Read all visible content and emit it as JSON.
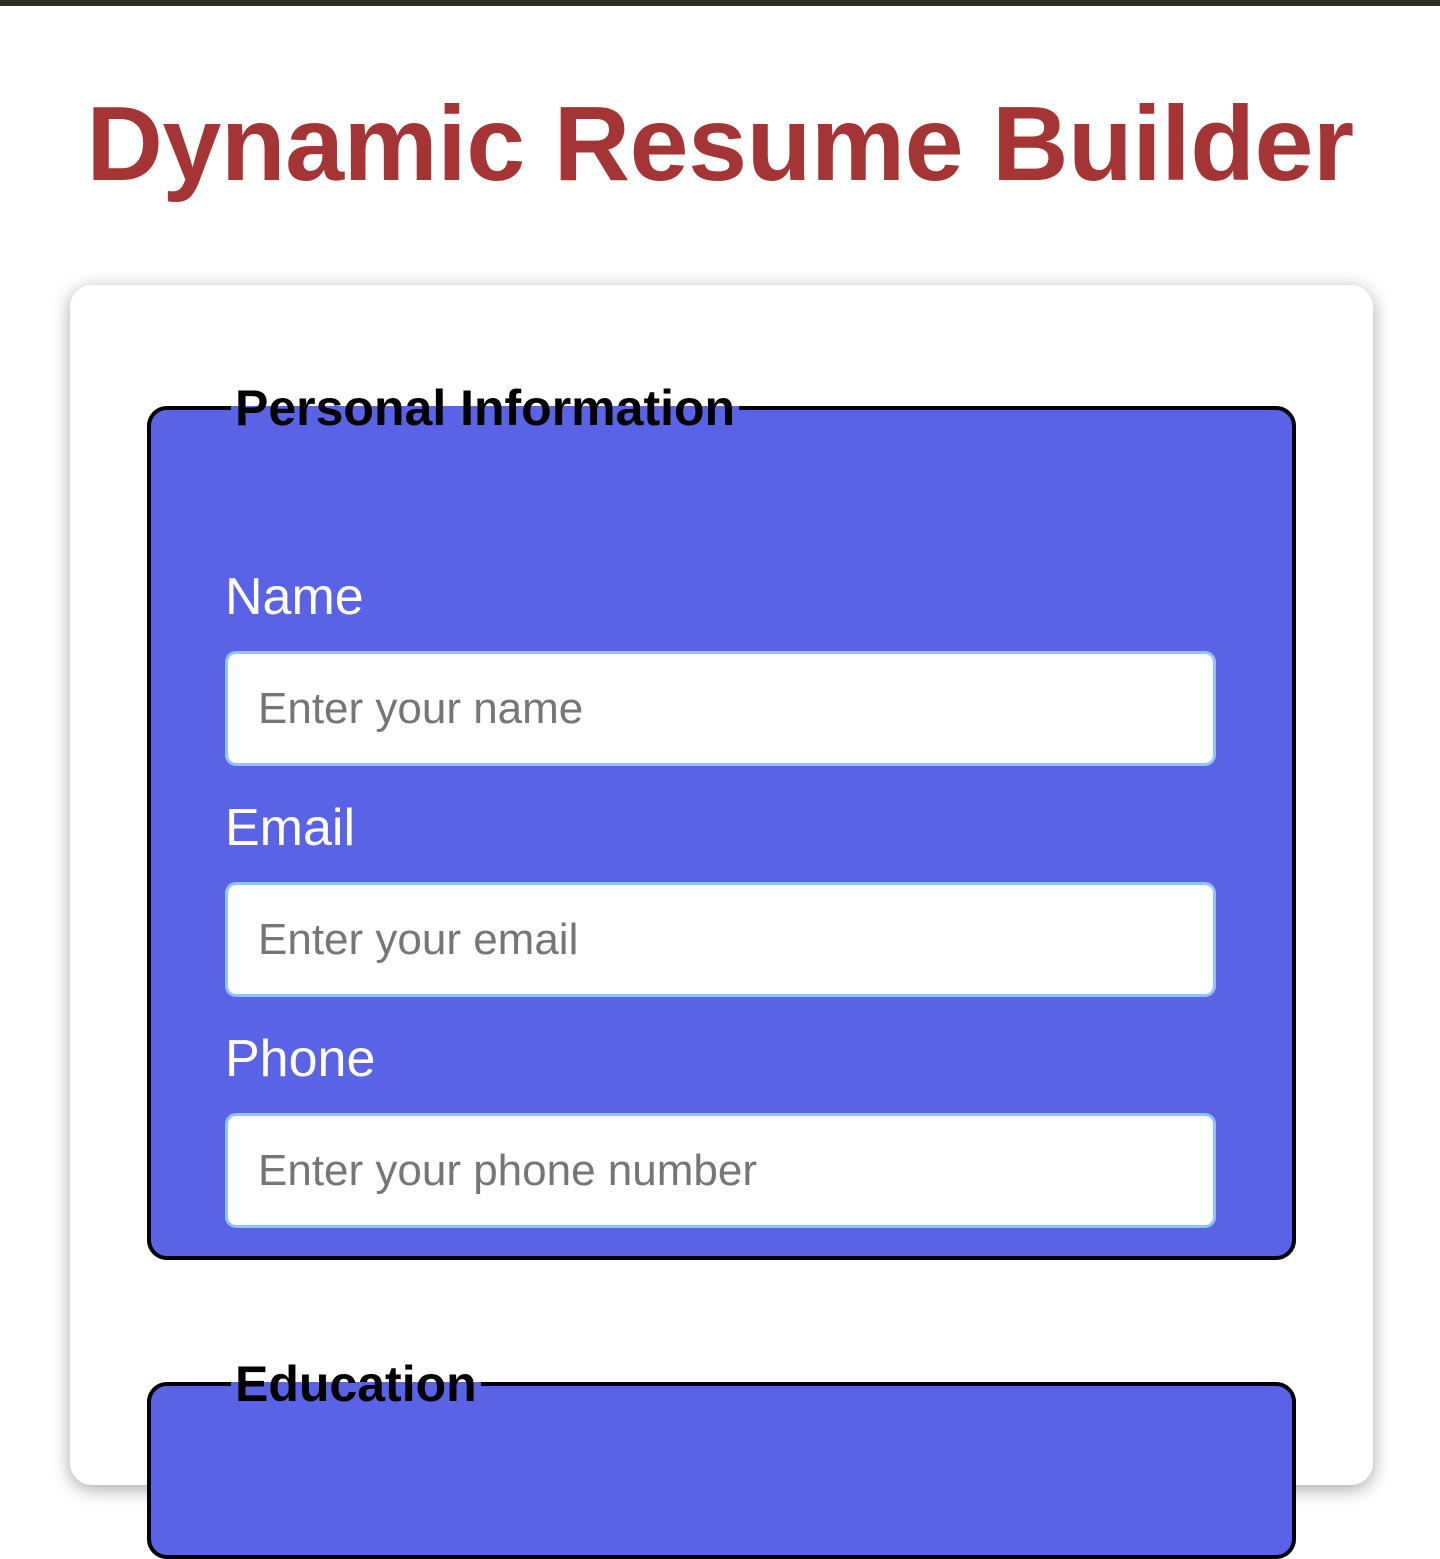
{
  "header": {
    "title": "Dynamic Resume Builder"
  },
  "colors": {
    "title": "#a53434",
    "section_background": "#5a63e5",
    "section_border": "#000000",
    "input_border": "#8fc2f5"
  },
  "sections": {
    "personal": {
      "legend": "Personal Information",
      "fields": [
        {
          "label": "Name",
          "value": "",
          "placeholder": "Enter your name"
        },
        {
          "label": "Email",
          "value": "",
          "placeholder": "Enter your email"
        },
        {
          "label": "Phone",
          "value": "",
          "placeholder": "Enter your phone number"
        }
      ]
    },
    "education": {
      "legend": "Education"
    }
  }
}
